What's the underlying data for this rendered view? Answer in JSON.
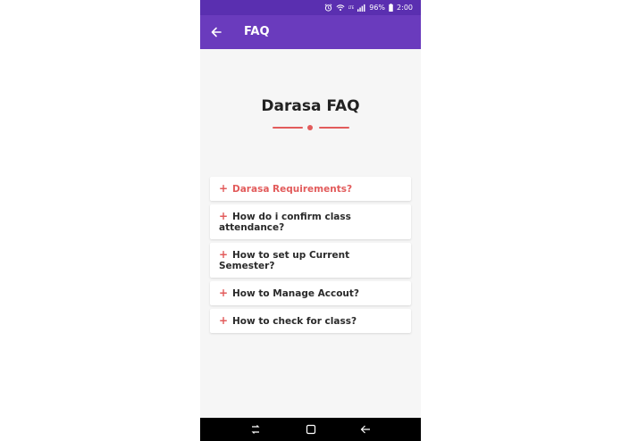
{
  "status_bar": {
    "battery_text": "96%",
    "time": "2:00",
    "network_label": "LTE",
    "icons": [
      "alarm-icon",
      "wifi-icon",
      "signal-icon",
      "battery-icon"
    ]
  },
  "app_bar": {
    "title": "FAQ",
    "back_icon": "arrow-left-icon"
  },
  "main": {
    "heading": "Darasa FAQ",
    "accent_color": "#e25b5b"
  },
  "faq": {
    "items": [
      {
        "plus": "+",
        "question": "Darasa Requirements?",
        "active": true
      },
      {
        "plus": "+",
        "question": "How do i confirm class attendance?",
        "active": false
      },
      {
        "plus": "+",
        "question": "How to set up Current Semester?",
        "active": false
      },
      {
        "plus": "+",
        "question": "How to Manage Accout?",
        "active": false
      },
      {
        "plus": "+",
        "question": "How to check for class?",
        "active": false
      }
    ]
  },
  "nav_bar": {
    "icons": [
      "recent-apps-icon",
      "home-icon",
      "back-icon"
    ]
  },
  "colors": {
    "primary": "#6a3bbd",
    "status_bar": "#5a2fb0",
    "accent": "#e25b5b",
    "background": "#f6f6f6"
  }
}
